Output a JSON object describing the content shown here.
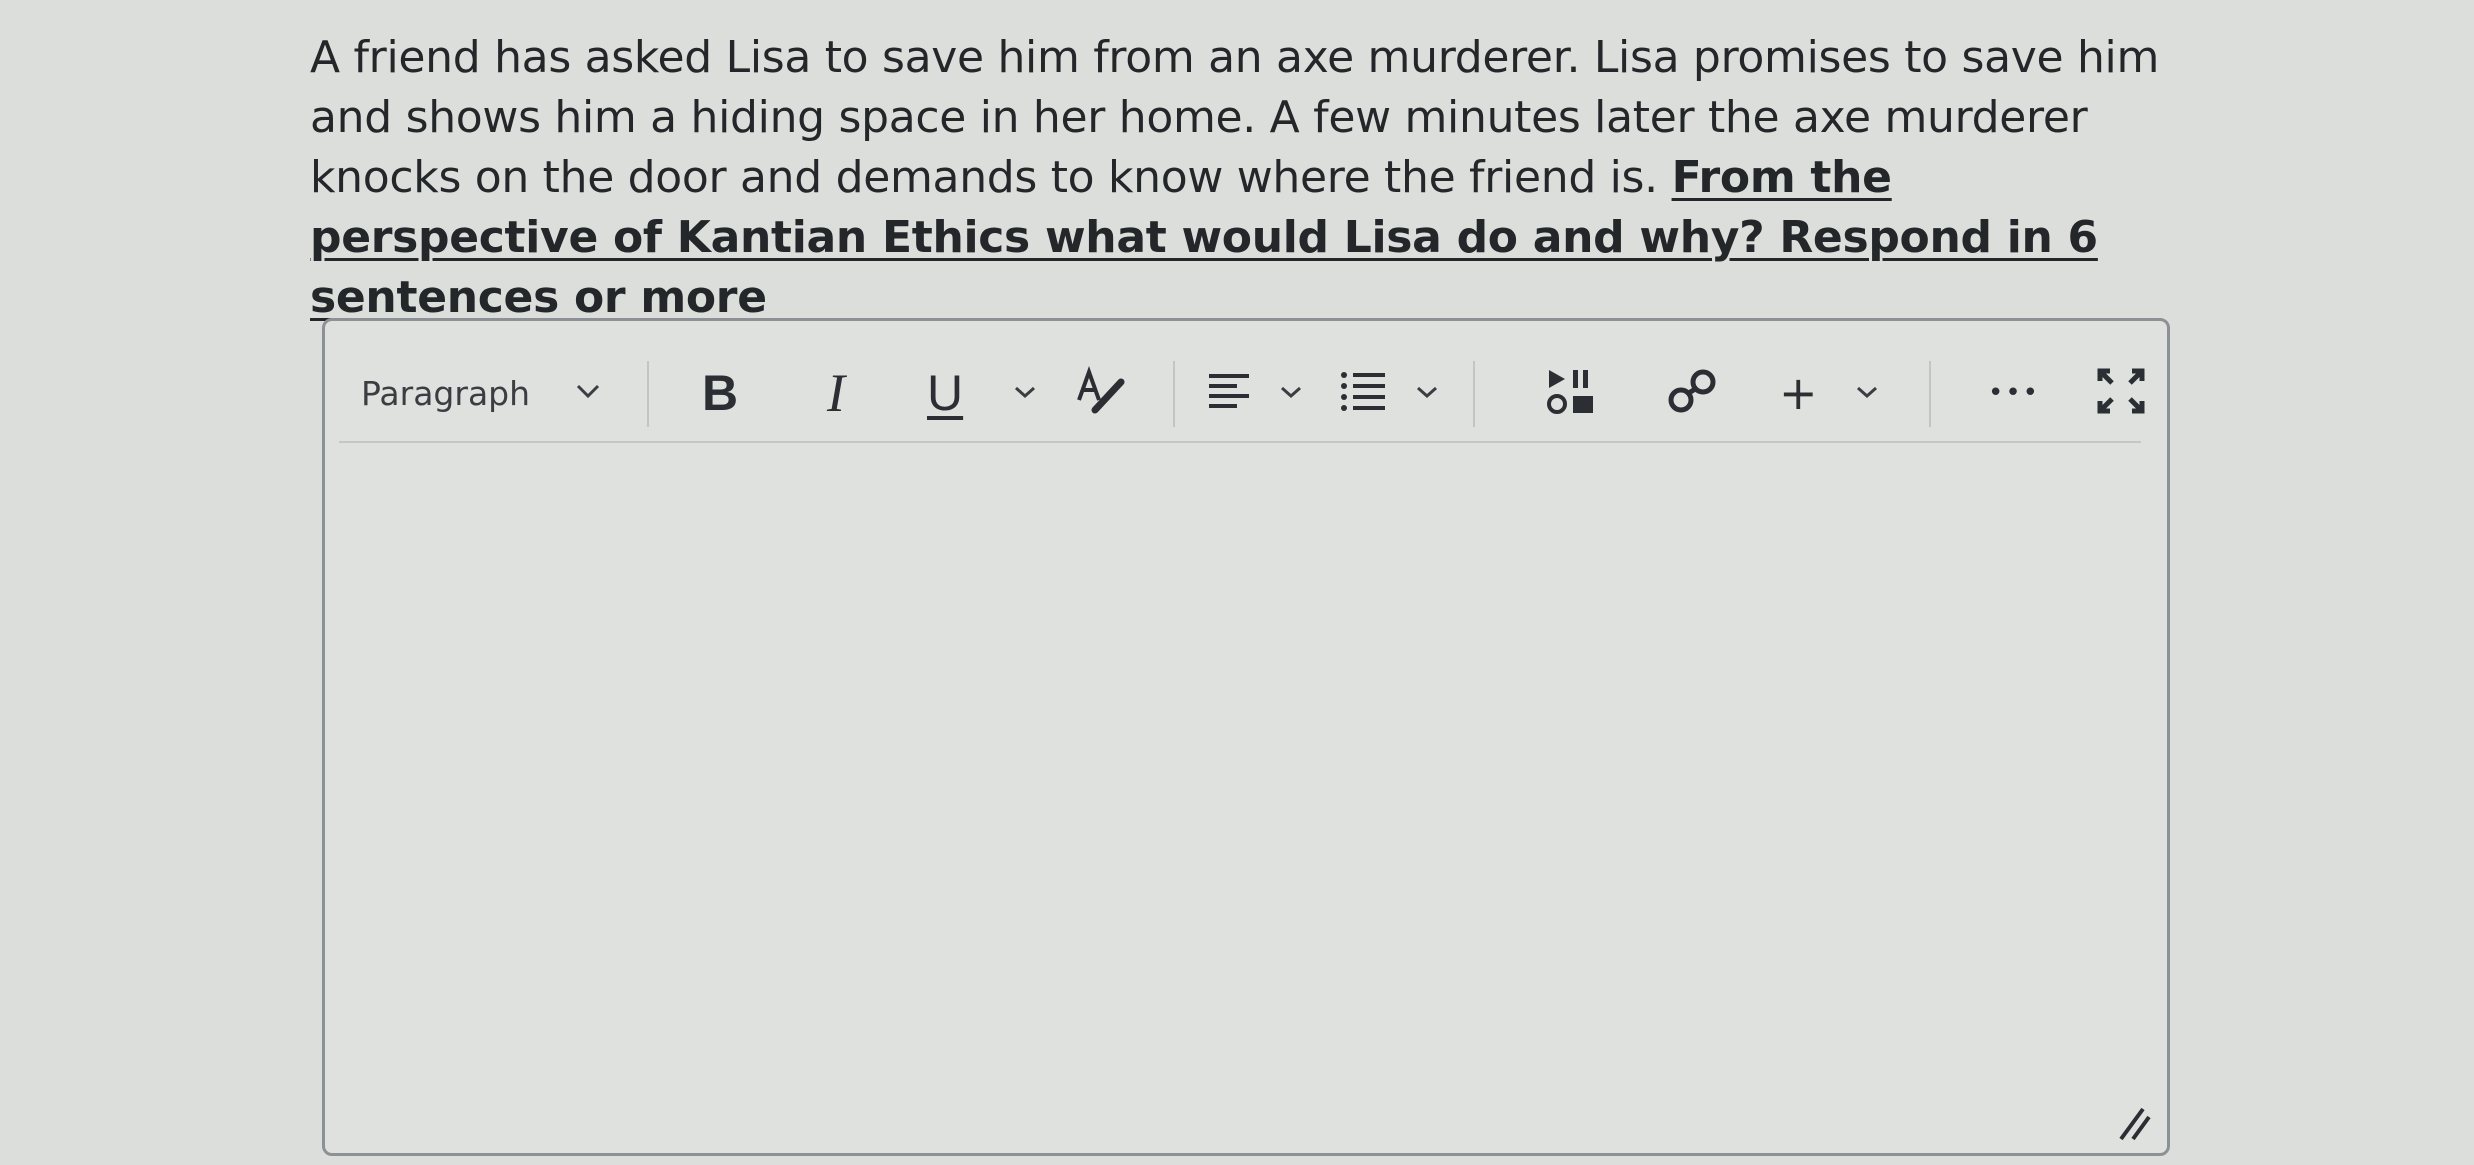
{
  "question": {
    "plain": "A friend has asked Lisa to save him from an axe murderer. Lisa promises to save him and shows him a hiding space in her home. A few minutes later the axe murderer knocks on the door and demands to know where the friend is. ",
    "emphasis": "From the perspective of Kantian Ethics what would Lisa do and why? Respond in 6 sentences or more"
  },
  "toolbar": {
    "block_format": "Paragraph",
    "bold_label": "B",
    "italic_label": "I",
    "underline_label": "U",
    "insert_label": "+",
    "more_label": "•••"
  },
  "editor": {
    "content": ""
  }
}
